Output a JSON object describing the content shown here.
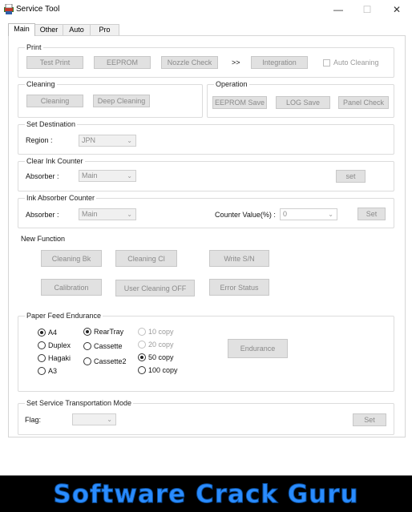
{
  "window": {
    "title": "Service Tool",
    "minimize": "—",
    "maximize": "☐",
    "close": "✕"
  },
  "tabs": [
    "Main",
    "Other",
    "Auto",
    "Pro"
  ],
  "print": {
    "label": "Print",
    "test_print": "Test Print",
    "eeprom": "EEPROM",
    "nozzle_check": "Nozzle Check",
    "arrows": ">>",
    "integration": "Integration",
    "auto_cleaning": "Auto Cleaning"
  },
  "cleaning": {
    "label": "Cleaning",
    "cleaning": "Cleaning",
    "deep_cleaning": "Deep Cleaning"
  },
  "operation": {
    "label": "Operation",
    "eeprom_save": "EEPROM Save",
    "log_save": "LOG Save",
    "panel_check": "Panel Check"
  },
  "destination": {
    "label": "Set Destination",
    "region_label": "Region :",
    "region_value": "JPN"
  },
  "clear_ink": {
    "label": "Clear Ink Counter",
    "absorber_label": "Absorber :",
    "absorber_value": "Main",
    "set": "set"
  },
  "ink_absorber": {
    "label": "Ink Absorber Counter",
    "absorber_label": "Absorber :",
    "absorber_value": "Main",
    "counter_label": "Counter Value(%) :",
    "counter_value": "0",
    "set": "Set"
  },
  "new_function": {
    "label": "New Function",
    "cleaning_bk": "Cleaning Bk",
    "cleaning_cl": "Cleaning Cl",
    "write_sn": "Write S/N",
    "calibration": "Calibration",
    "user_cleaning_off": "User Cleaning OFF",
    "error_status": "Error Status"
  },
  "paper_feed": {
    "label": "Paper Feed Endurance",
    "sizes": [
      "A4",
      "Duplex",
      "Hagaki",
      "A3"
    ],
    "trays": [
      "RearTray",
      "Cassette",
      "Cassette2"
    ],
    "copies": [
      "10 copy",
      "20 copy",
      "50 copy",
      "100 copy"
    ],
    "endurance": "Endurance"
  },
  "transport": {
    "label": "Set Service Transportation Mode",
    "flag_label": "Flag:",
    "flag_value": "",
    "set": "Set"
  },
  "banner": {
    "text": "Software Crack Guru"
  }
}
